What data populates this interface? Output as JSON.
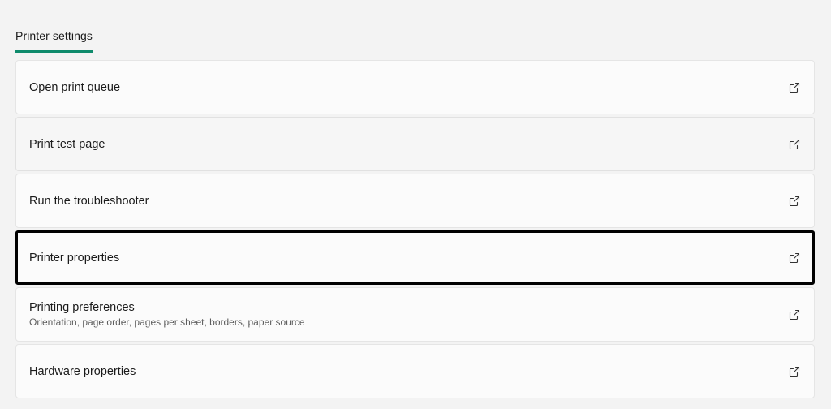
{
  "section": {
    "tab_label": "Printer settings"
  },
  "items": [
    {
      "title": "Open print queue",
      "subtitle": "",
      "icon": "open-external-icon"
    },
    {
      "title": "Print test page",
      "subtitle": "",
      "icon": "open-external-icon"
    },
    {
      "title": "Run the troubleshooter",
      "subtitle": "",
      "icon": "open-external-icon"
    },
    {
      "title": "Printer properties",
      "subtitle": "",
      "icon": "open-external-icon"
    },
    {
      "title": "Printing preferences",
      "subtitle": "Orientation, page order, pages per sheet, borders, paper source",
      "icon": "open-external-icon"
    },
    {
      "title": "Hardware properties",
      "subtitle": "",
      "icon": "open-external-icon"
    }
  ],
  "colors": {
    "accent": "#0f8b6c",
    "background": "#f3f3f3",
    "card": "#fbfbfb",
    "focus_border": "#000000"
  }
}
